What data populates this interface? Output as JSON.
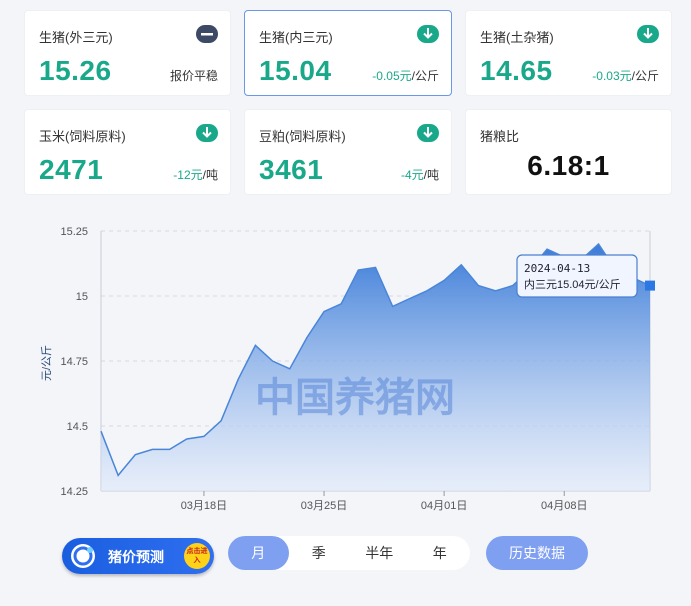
{
  "cards": [
    {
      "name": "生猪(外三元)",
      "price": "15.26",
      "change": "报价平稳",
      "change_num": "",
      "change_unit": ""
    },
    {
      "name": "生猪(内三元)",
      "price": "15.04",
      "change": "",
      "change_num": "-0.05元",
      "change_unit": "/公斤"
    },
    {
      "name": "生猪(土杂猪)",
      "price": "14.65",
      "change": "",
      "change_num": "-0.03元",
      "change_unit": "/公斤"
    },
    {
      "name": "玉米(饲料原料)",
      "price": "2471",
      "change": "",
      "change_num": "-12元",
      "change_unit": "/吨"
    },
    {
      "name": "豆粕(饲料原料)",
      "price": "3461",
      "change": "",
      "change_num": "-4元",
      "change_unit": "/吨"
    },
    {
      "name": "猪粮比",
      "price": "6.18:1",
      "change": "",
      "change_num": "",
      "change_unit": ""
    }
  ],
  "tooltip": {
    "date": "2024-04-13",
    "text": "内三元15.04元/公斤"
  },
  "watermark": "中国养猪网",
  "controls": {
    "predict_label": "猪价预测",
    "predict_badge": "点击进入",
    "tabs": [
      "月",
      "季",
      "半年",
      "年"
    ],
    "history_label": "历史数据"
  },
  "colors": {
    "accent": "#1aa88a",
    "line": "#4a86d8",
    "tab_selected": "#7f9ff0"
  },
  "chart_data": {
    "type": "area",
    "ylabel": "元/公斤",
    "ylim": [
      14.25,
      15.25
    ],
    "yticks": [
      "15.25",
      "15",
      "14.75",
      "14.5",
      "14.25"
    ],
    "xticks": [
      {
        "label": "03月18日",
        "index": 6
      },
      {
        "label": "03月25日",
        "index": 13
      },
      {
        "label": "04月01日",
        "index": 20
      },
      {
        "label": "04月08日",
        "index": 27
      }
    ],
    "x": [
      "03-12",
      "03-13",
      "03-14",
      "03-15",
      "03-16",
      "03-17",
      "03-18",
      "03-19",
      "03-20",
      "03-21",
      "03-22",
      "03-23",
      "03-24",
      "03-25",
      "03-26",
      "03-27",
      "03-28",
      "03-29",
      "03-30",
      "03-31",
      "04-01",
      "04-02",
      "04-03",
      "04-04",
      "04-05",
      "04-06",
      "04-07",
      "04-08",
      "04-09",
      "04-10",
      "04-11",
      "04-12",
      "04-13"
    ],
    "values": [
      14.48,
      14.31,
      14.39,
      14.41,
      14.41,
      14.45,
      14.46,
      14.52,
      14.68,
      14.81,
      14.75,
      14.72,
      14.84,
      14.94,
      14.97,
      15.1,
      15.11,
      14.96,
      14.99,
      15.02,
      15.06,
      15.12,
      15.04,
      15.02,
      15.04,
      15.1,
      15.18,
      15.15,
      15.14,
      15.2,
      15.1,
      15.07,
      15.04
    ],
    "grid": true,
    "highlight_index": 32
  }
}
